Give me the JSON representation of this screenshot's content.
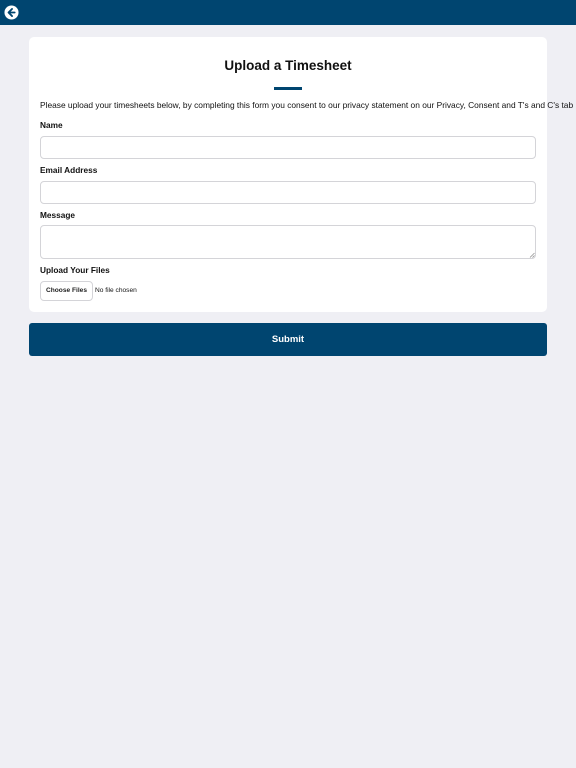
{
  "header": {
    "back_icon": "arrow-left-circle-icon",
    "background_color": "#004570"
  },
  "form": {
    "title": "Upload a Timesheet",
    "consent_text": "Please upload your timesheets below, by completing this form you consent to our privacy statement on our Privacy, Consent and T's and C's tab",
    "name_label": "Name",
    "name_value": "",
    "email_label": "Email Address",
    "email_value": "",
    "message_label": "Message",
    "message_value": "",
    "upload_label": "Upload Your Files",
    "choose_files_label": "Choose Files",
    "file_status": "No file chosen"
  },
  "submit": {
    "label": "Submit"
  },
  "colors": {
    "accent": "#004570",
    "page_background": "#efeff4",
    "card_background": "#ffffff"
  }
}
